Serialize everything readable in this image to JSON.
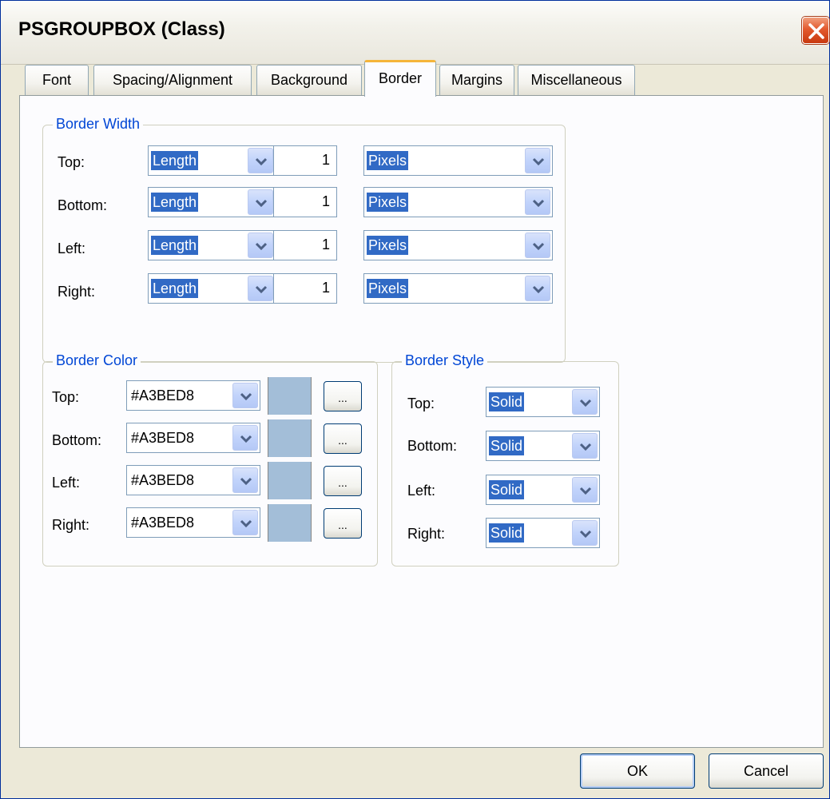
{
  "window": {
    "title": "PSGROUPBOX (Class)"
  },
  "tabs": [
    "Font",
    "Spacing/Alignment",
    "Background",
    "Border",
    "Margins",
    "Miscellaneous"
  ],
  "active_tab": "Border",
  "border_width": {
    "title": "Border Width",
    "rows": [
      {
        "label": "Top:",
        "type": "Length",
        "value": "1",
        "unit": "Pixels"
      },
      {
        "label": "Bottom:",
        "type": "Length",
        "value": "1",
        "unit": "Pixels"
      },
      {
        "label": "Left:",
        "type": "Length",
        "value": "1",
        "unit": "Pixels"
      },
      {
        "label": "Right:",
        "type": "Length",
        "value": "1",
        "unit": "Pixels"
      }
    ]
  },
  "border_color": {
    "title": "Border Color",
    "rows": [
      {
        "label": "Top:",
        "color": "#A3BED8",
        "button": "..."
      },
      {
        "label": "Bottom:",
        "color": "#A3BED8",
        "button": "..."
      },
      {
        "label": "Left:",
        "color": "#A3BED8",
        "button": "..."
      },
      {
        "label": "Right:",
        "color": "#A3BED8",
        "button": "..."
      }
    ]
  },
  "border_style": {
    "title": "Border Style",
    "rows": [
      {
        "label": "Top:",
        "style": "Solid"
      },
      {
        "label": "Bottom:",
        "style": "Solid"
      },
      {
        "label": "Left:",
        "style": "Solid"
      },
      {
        "label": "Right:",
        "style": "Solid"
      }
    ]
  },
  "buttons": {
    "ok": "OK",
    "cancel": "Cancel"
  },
  "colors": {
    "title_bg": "#ece9d8",
    "accent": "#316ac5",
    "group_label": "#0046d5",
    "swatch": "#a3bed8"
  },
  "icons": {
    "close": "close-icon",
    "dropdown": "chevron-down-icon"
  }
}
